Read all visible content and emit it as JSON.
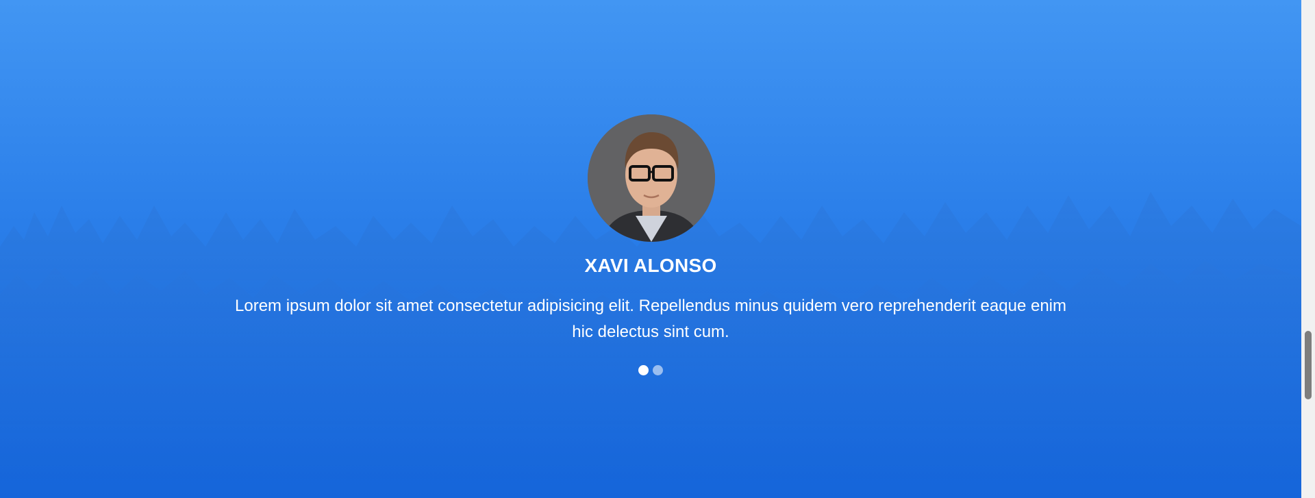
{
  "testimonial": {
    "name": "XAVI ALONSO",
    "quote": "Lorem ipsum dolor sit amet consectetur adipisicing elit. Repellendus minus quidem vero reprehenderit eaque enim hic delectus sint cum.",
    "avatar_icon": "person-portrait",
    "slides_count": 2,
    "active_slide": 1
  },
  "colors": {
    "background_top": "#4296f3",
    "background_bottom": "#1467de",
    "text": "#ffffff"
  }
}
